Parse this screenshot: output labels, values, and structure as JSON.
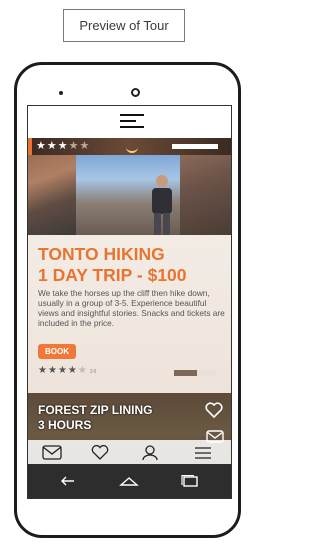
{
  "header": {
    "preview_label": "Preview of Tour"
  },
  "top_card": {
    "top_rating": 3,
    "top_rating_max": 5,
    "title_line1": "TONTO HIKING",
    "title_line2": "1 DAY TRIP - $100",
    "description": "We take the horses up the cliff then hike down, usually in a group of 3-5. Experience beautiful views and insightful stories. Snacks and tickets are included in the price.",
    "book_label": "BOOK",
    "rating": 4,
    "rating_max": 5,
    "review_count": "36",
    "progress_fraction": 0.55
  },
  "second_card": {
    "title_line1": "FOREST ZIP LINING",
    "title_line2": "3 HOURS"
  },
  "colors": {
    "accent": "#e8742f",
    "book_button": "#f0793a",
    "system_bar": "#2d2d2d"
  },
  "icons": {
    "menu": "menu-icon",
    "mail": "mail-icon",
    "heart": "heart-icon",
    "profile": "profile-icon",
    "back": "back-icon",
    "home": "home-icon",
    "recent": "recent-apps-icon"
  }
}
